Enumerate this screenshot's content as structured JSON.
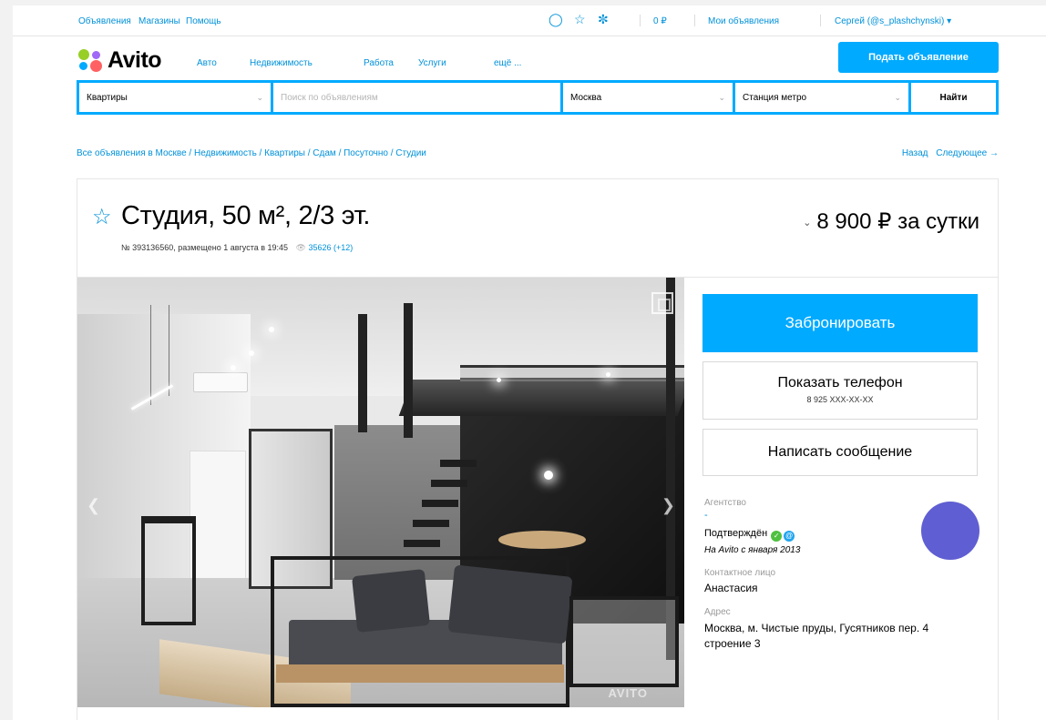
{
  "topbar": {
    "links": [
      "Объявления",
      "Магазины",
      "Помощь"
    ],
    "icons": [
      "chat-icon",
      "star-icon",
      "notifications-icon"
    ],
    "balance": "0 ₽",
    "my_ads": "Мои объявления",
    "user": "Сергей (@s_plashchynski) ▾"
  },
  "header": {
    "logo": "Avito",
    "nav": [
      "Авто",
      "Недвижимость",
      "Работа",
      "Услуги",
      "ещё ..."
    ],
    "post_button": "Подать объявление"
  },
  "search": {
    "category": "Квартиры",
    "query_placeholder": "Поиск по объявлениям",
    "city": "Москва",
    "metro": "Станция метро",
    "find_button": "Найти"
  },
  "breadcrumb": "Все объявления в Москве / Недвижимость / Квартиры / Сдам / Посуточно / Студии",
  "pager": {
    "back": "Назад",
    "next": "Следующее →"
  },
  "listing": {
    "title": "Студия, 50 м², 2/3 эт.",
    "meta": "№ 393136560, размещено 1 августа в 19:45",
    "views": "35626 (+12)",
    "price": "8 900 ₽ за сутки",
    "watermark": "AVITO"
  },
  "actions": {
    "book": "Забронировать",
    "show_phone": "Показать телефон",
    "phone_masked": "8 925 XXX-XX-XX",
    "message": "Написать сообщение"
  },
  "seller": {
    "type_label": "Агентство",
    "name_placeholder": "-",
    "verified": "Подтверждён",
    "since": "На Avito с января 2013",
    "contact_label": "Контактное лицо",
    "contact": "Анастасия",
    "address_label": "Адрес",
    "address": "Москва, м. Чистые пруды, Гусятников пер. 4 строение 3",
    "avatar_color": "#5f5ed2"
  },
  "colors": {
    "accent": "#00aaff",
    "link": "#0091d9"
  }
}
